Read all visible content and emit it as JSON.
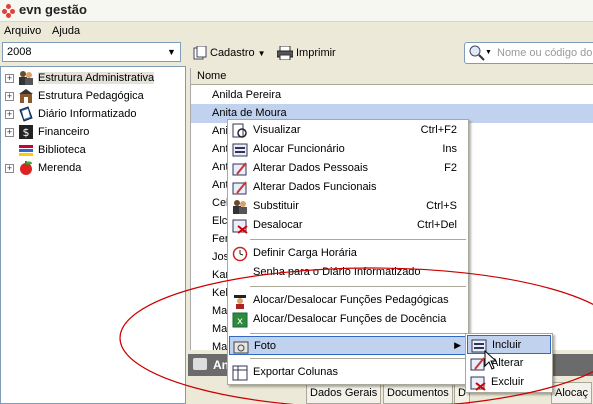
{
  "app": {
    "title": "evn gestão"
  },
  "menubar": {
    "items": [
      "Arquivo",
      "Ajuda"
    ]
  },
  "year_select": {
    "value": "2008"
  },
  "toolbar": {
    "cadastro_label": "Cadastro",
    "imprimir_label": "Imprimir"
  },
  "search": {
    "placeholder": "Nome ou código do f"
  },
  "tree": {
    "items": [
      {
        "label": "Estrutura Administrativa"
      },
      {
        "label": "Estrutura Pedagógica"
      },
      {
        "label": "Diário Informatizado"
      },
      {
        "label": "Financeiro"
      },
      {
        "label": "Biblioteca"
      },
      {
        "label": "Merenda"
      }
    ]
  },
  "grid": {
    "header": "Nome",
    "rows": [
      "Anilda Pereira",
      "Anita de Moura",
      "Anil",
      "Ant",
      "Ant",
      "Ant",
      "Cel",
      "Elci",
      "Fer",
      "Jos",
      "Kar",
      "Kell",
      "Mar",
      "Mar",
      "Mar"
    ]
  },
  "detail": {
    "title": "An"
  },
  "tabs": [
    "Dados Gerais",
    "Documentos",
    "D",
    "Alocaç"
  ],
  "context_menu": {
    "items": [
      {
        "label": "Visualizar",
        "shortcut": "Ctrl+F2"
      },
      {
        "label": "Alocar Funcionário",
        "shortcut": "Ins"
      },
      {
        "label": "Alterar Dados Pessoais",
        "shortcut": "F2"
      },
      {
        "label": "Alterar Dados Funcionais",
        "shortcut": ""
      },
      {
        "label": "Substituir",
        "shortcut": "Ctrl+S"
      },
      {
        "label": "Desalocar",
        "shortcut": "Ctrl+Del"
      },
      {
        "label": "Definir Carga Horária",
        "shortcut": ""
      },
      {
        "label": "Senha para o Diário Informatizado",
        "shortcut": ""
      },
      {
        "label": "Alocar/Desalocar Funções Pedagógicas",
        "shortcut": ""
      },
      {
        "label": "Alocar/Desalocar Funções de Docência",
        "shortcut": ""
      },
      {
        "label": "Foto",
        "shortcut": ""
      },
      {
        "label": "Exportar Colunas",
        "shortcut": ""
      }
    ]
  },
  "foto_submenu": {
    "items": [
      "Incluir",
      "Alterar",
      "Excluir"
    ]
  },
  "colors": {
    "selection": "#c1d2ee",
    "highlight_border": "#316ac5",
    "annotation_ellipse": "#cc0000"
  }
}
